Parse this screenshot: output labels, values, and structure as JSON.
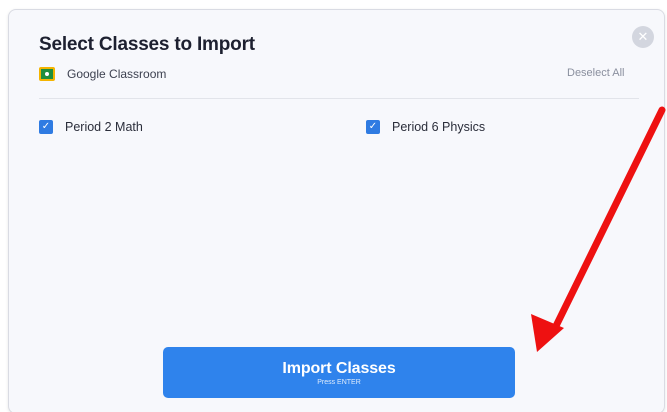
{
  "modal": {
    "title": "Select Classes to Import",
    "close_icon": "close-icon",
    "source": {
      "icon": "google-classroom-icon",
      "name": "Google Classroom"
    },
    "deselect_all_label": "Deselect All",
    "classes": [
      {
        "label": "Period 2 Math",
        "checked": true
      },
      {
        "label": "Period 6 Physics",
        "checked": true
      }
    ],
    "checkbox_mark": "✓",
    "import_button": {
      "label": "Import Classes",
      "hint": "Press ENTER"
    }
  },
  "annotation": {
    "type": "arrow",
    "color": "#ee1111",
    "points_to": "import-classes-button"
  },
  "colors": {
    "accent": "#2f83ec",
    "checkbox": "#2f7be2",
    "background": "#f7f8fc"
  }
}
